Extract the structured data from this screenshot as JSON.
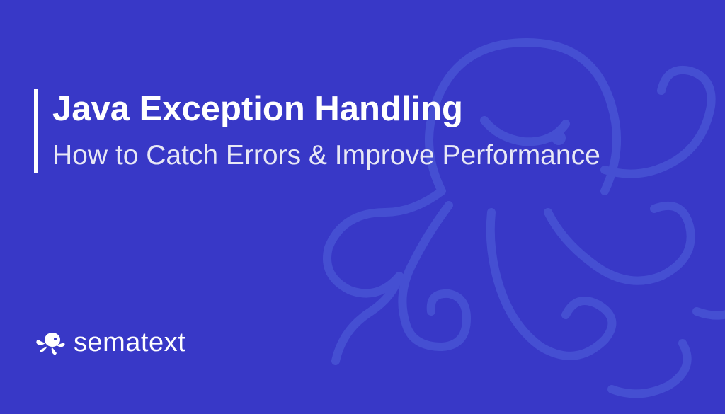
{
  "card": {
    "title": "Java Exception Handling",
    "subtitle": "How to Catch Errors & Improve Performance"
  },
  "brand": {
    "name": "sematext",
    "icon": "octopus-logo-icon"
  },
  "bg": {
    "icon": "octopus-outline-icon"
  },
  "colors": {
    "background": "#3838c7",
    "accent": "#5f7ce8",
    "text": "#ffffff"
  }
}
